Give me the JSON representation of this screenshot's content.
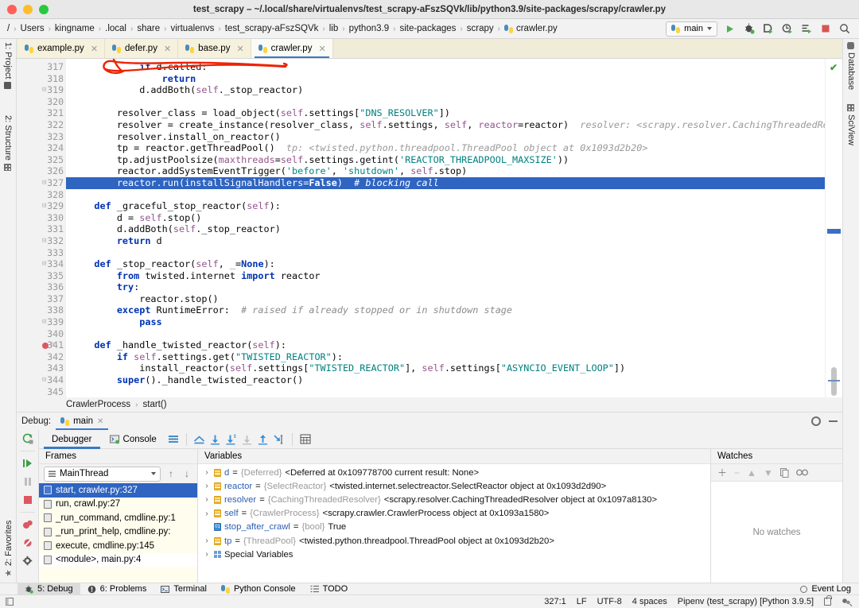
{
  "window": {
    "title": "test_scrapy – ~/.local/share/virtualenvs/test_scrapy-aFszSQVk/lib/python3.9/site-packages/scrapy/crawler.py",
    "traffic_lights": [
      "close-red",
      "minimize-yellow",
      "maximize-green"
    ]
  },
  "navbar": {
    "breadcrumbs": [
      "/",
      "Users",
      "kingname",
      ".local",
      "share",
      "virtualenvs",
      "test_scrapy-aFszSQVk",
      "lib",
      "python3.9",
      "site-packages",
      "scrapy",
      "crawler.py"
    ],
    "run_config": "main",
    "buttons": [
      "run",
      "debug",
      "run-with-coverage",
      "profile",
      "run-with-console",
      "stop",
      "search"
    ]
  },
  "tabs": [
    {
      "label": "example.py",
      "active": false
    },
    {
      "label": "defer.py",
      "active": false
    },
    {
      "label": "base.py",
      "active": false
    },
    {
      "label": "crawler.py",
      "active": true
    }
  ],
  "left_stripe": [
    {
      "label": "1: Project",
      "icon": "folder-icon"
    },
    {
      "label": "2: Structure",
      "icon": "structure-icon"
    },
    {
      "label": "2: Favorites",
      "icon": "star-icon"
    }
  ],
  "right_stripe": [
    {
      "label": "Database",
      "icon": "database-icon"
    },
    {
      "label": "SciView",
      "icon": "grid-icon"
    }
  ],
  "editor": {
    "first_line": 317,
    "highlighted_line": 327,
    "breakpoint_line": 341,
    "inspection_status": "ok-check",
    "lines": [
      {
        "n": 317,
        "fold": false,
        "text": "            if d.called:"
      },
      {
        "n": 318,
        "fold": false,
        "text": "                return"
      },
      {
        "n": 319,
        "fold": true,
        "text": "            d.addBoth(self._stop_reactor)"
      },
      {
        "n": 320,
        "fold": false,
        "text": ""
      },
      {
        "n": 321,
        "fold": false,
        "text": "        resolver_class = load_object(self.settings[\"DNS_RESOLVER\"])"
      },
      {
        "n": 322,
        "fold": false,
        "text": "        resolver = create_instance(resolver_class, self.settings, self, reactor=reactor)",
        "hint": "resolver: <scrapy.resolver.CachingThreadedResolver object"
      },
      {
        "n": 323,
        "fold": false,
        "text": "        resolver.install_on_reactor()"
      },
      {
        "n": 324,
        "fold": false,
        "text": "        tp = reactor.getThreadPool()",
        "hint": "tp: <twisted.python.threadpool.ThreadPool object at 0x1093d2b20>"
      },
      {
        "n": 325,
        "fold": false,
        "text": "        tp.adjustPoolsize(maxthreads=self.settings.getint('REACTOR_THREADPOOL_MAXSIZE'))"
      },
      {
        "n": 326,
        "fold": false,
        "text": "        reactor.addSystemEventTrigger('before', 'shutdown', self.stop)"
      },
      {
        "n": 327,
        "fold": true,
        "text": "        reactor.run(installSignalHandlers=False)  # blocking call"
      },
      {
        "n": 328,
        "fold": false,
        "text": ""
      },
      {
        "n": 329,
        "fold": true,
        "text": "    def _graceful_stop_reactor(self):"
      },
      {
        "n": 330,
        "fold": false,
        "text": "        d = self.stop()"
      },
      {
        "n": 331,
        "fold": false,
        "text": "        d.addBoth(self._stop_reactor)"
      },
      {
        "n": 332,
        "fold": true,
        "text": "        return d"
      },
      {
        "n": 333,
        "fold": false,
        "text": ""
      },
      {
        "n": 334,
        "fold": true,
        "text": "    def _stop_reactor(self, _=None):"
      },
      {
        "n": 335,
        "fold": false,
        "text": "        from twisted.internet import reactor"
      },
      {
        "n": 336,
        "fold": false,
        "text": "        try:"
      },
      {
        "n": 337,
        "fold": false,
        "text": "            reactor.stop()"
      },
      {
        "n": 338,
        "fold": false,
        "text": "        except RuntimeError:  # raised if already stopped or in shutdown stage"
      },
      {
        "n": 339,
        "fold": true,
        "text": "            pass"
      },
      {
        "n": 340,
        "fold": false,
        "text": ""
      },
      {
        "n": 341,
        "fold": true,
        "text": "    def _handle_twisted_reactor(self):"
      },
      {
        "n": 342,
        "fold": false,
        "text": "        if self.settings.get(\"TWISTED_REACTOR\"):"
      },
      {
        "n": 343,
        "fold": false,
        "text": "            install_reactor(self.settings[\"TWISTED_REACTOR\"], self.settings[\"ASYNCIO_EVENT_LOOP\"])"
      },
      {
        "n": 344,
        "fold": true,
        "text": "        super()._handle_twisted_reactor()"
      },
      {
        "n": 345,
        "fold": false,
        "text": ""
      }
    ],
    "breadcrumb": [
      "CrawlerProcess",
      "start()"
    ]
  },
  "debug": {
    "label": "Debug:",
    "session_tab": "main",
    "tabs": [
      {
        "label": "Debugger",
        "active": true,
        "icon": null
      },
      {
        "label": "Console",
        "active": false,
        "icon": "console-icon"
      }
    ],
    "toolbar_icons": [
      "mute-layout-icon",
      "show-execution-point-icon",
      "step-over-icon",
      "step-into-icon",
      "force-step-into-icon",
      "step-out-icon",
      "run-to-cursor-icon",
      "evaluate-expression-icon"
    ],
    "side_icons": [
      "rerun-icon",
      "resume-icon",
      "pause-icon",
      "stop-icon",
      "view-breakpoints-icon",
      "mute-breakpoints-icon",
      "settings-icon"
    ],
    "frames": {
      "title": "Frames",
      "thread": "MainThread",
      "items": [
        {
          "label": "start, crawler.py:327",
          "selected": true
        },
        {
          "label": "run, crawl.py:27",
          "selected": false
        },
        {
          "label": "_run_command, cmdline.py:1",
          "selected": false
        },
        {
          "label": "_run_print_help, cmdline.py:",
          "selected": false
        },
        {
          "label": "execute, cmdline.py:145",
          "selected": false
        },
        {
          "label": "<module>, main.py:4",
          "selected": false
        }
      ]
    },
    "variables": {
      "title": "Variables",
      "items": [
        {
          "expandable": true,
          "kind": "object",
          "name": "d",
          "type": "{Deferred}",
          "value": "<Deferred at 0x109778700 current result: None>"
        },
        {
          "expandable": true,
          "kind": "object",
          "name": "reactor",
          "type": "{SelectReactor}",
          "value": "<twisted.internet.selectreactor.SelectReactor object at 0x1093d2d90>"
        },
        {
          "expandable": true,
          "kind": "object",
          "name": "resolver",
          "type": "{CachingThreadedResolver}",
          "value": "<scrapy.resolver.CachingThreadedResolver object at 0x1097a8130>"
        },
        {
          "expandable": true,
          "kind": "object",
          "name": "self",
          "type": "{CrawlerProcess}",
          "value": "<scrapy.crawler.CrawlerProcess object at 0x1093a1580>"
        },
        {
          "expandable": false,
          "kind": "bool",
          "name": "stop_after_crawl",
          "type": "{bool}",
          "value": "True"
        },
        {
          "expandable": true,
          "kind": "object",
          "name": "tp",
          "type": "{ThreadPool}",
          "value": "<twisted.python.threadpool.ThreadPool object at 0x1093d2b20>"
        },
        {
          "expandable": true,
          "kind": "special",
          "name": "Special Variables",
          "type": "",
          "value": ""
        }
      ]
    },
    "watches": {
      "title": "Watches",
      "toolbar_icons": [
        "add-icon",
        "remove-icon",
        "move-up-icon",
        "move-down-icon",
        "copy-icon",
        "inspect-icon"
      ],
      "empty_text": "No watches"
    }
  },
  "bottom_bar": {
    "buttons": [
      {
        "label": "5: Debug",
        "icon": "debug-icon",
        "active": true
      },
      {
        "label": "6: Problems",
        "icon": "problems-icon",
        "active": false
      },
      {
        "label": "Terminal",
        "icon": "terminal-icon",
        "active": false
      },
      {
        "label": "Python Console",
        "icon": "python-console-icon",
        "active": false
      },
      {
        "label": "TODO",
        "icon": "todo-icon",
        "active": false
      }
    ],
    "event_log": "Event Log"
  },
  "status_bar": {
    "caret": "327:1",
    "line_separator": "LF",
    "encoding": "UTF-8",
    "indent": "4 spaces",
    "interpreter": "Pipenv (test_scrapy) [Python 3.9.5]",
    "icons": [
      "lock-icon",
      "inspection-level-icon"
    ]
  },
  "colors": {
    "accent_blue": "#3b79c9",
    "selection_blue": "#2f64c1",
    "tab_yellow": "#f5f1dd",
    "frames_yellow": "#fffded",
    "annotation_red": "#ee2200",
    "keyword": "#0033b3",
    "string": "#067d17",
    "self": "#94558d",
    "comment": "#8c8c8c"
  }
}
